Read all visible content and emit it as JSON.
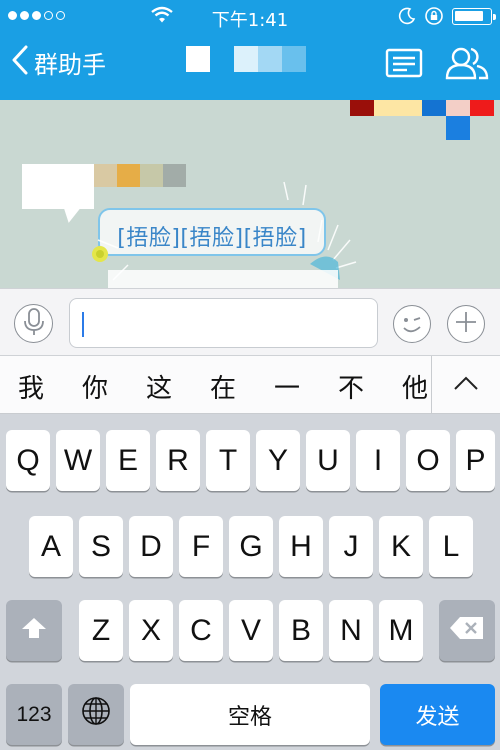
{
  "status_bar": {
    "time": "下午1:41",
    "signal_dots_filled": 3,
    "signal_dots_total": 5,
    "battery_level": 0.85,
    "icons": [
      "wifi-icon",
      "moon-icon",
      "rotation-lock-icon",
      "battery-icon"
    ]
  },
  "nav": {
    "back_label": "群助手",
    "back_icon": "chevron-left-icon",
    "right_icons": [
      "menu-list-icon",
      "group-members-icon"
    ]
  },
  "chat": {
    "ghost_bubble_text": "[捂脸][捂脸][捂脸]",
    "pixel_colors_top": [
      "#9a0f0a",
      "#fde6a4",
      "#fde6a4",
      "#1473d2",
      "#f3cfc7",
      "#ee1b1b"
    ],
    "pixel_colors_top_second": [
      "#1b7fe0"
    ],
    "pixel_colors_blur": [
      "#d9c9a3",
      "#e6ad47",
      "#c6c8a8",
      "#a2aca8"
    ]
  },
  "input": {
    "value": "",
    "placeholder": "",
    "icons": [
      "microphone-icon",
      "emoji-icon",
      "plus-icon"
    ]
  },
  "candidates": {
    "items": [
      "我",
      "你",
      "这",
      "在",
      "一",
      "不",
      "他"
    ],
    "expand_icon": "chevron-up-icon"
  },
  "keyboard": {
    "row1": [
      "Q",
      "W",
      "E",
      "R",
      "T",
      "Y",
      "U",
      "I",
      "O",
      "P"
    ],
    "row2": [
      "A",
      "S",
      "D",
      "F",
      "G",
      "H",
      "J",
      "K",
      "L"
    ],
    "row3": [
      "Z",
      "X",
      "C",
      "V",
      "B",
      "N",
      "M"
    ],
    "shift_icon": "shift-arrow-icon",
    "delete_icon": "backspace-icon",
    "numbers_label": "123",
    "globe_icon": "globe-icon",
    "space_label": "空格",
    "send_label": "发送",
    "accent_color": "#1a89f1"
  }
}
